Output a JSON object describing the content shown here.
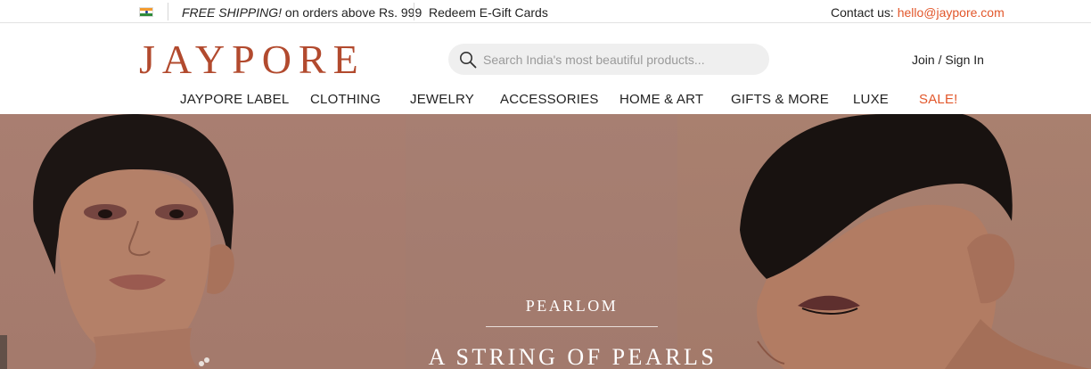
{
  "topbar": {
    "flag_icon": "india-flag-icon",
    "shipping_prefix": "FREE SHIPPING!",
    "shipping_rest": " on orders above Rs. 999",
    "gift_cards": "Redeem E-Gift Cards",
    "contact_label": "Contact us: ",
    "contact_email": "hello@jaypore.com"
  },
  "header": {
    "logo": "JAYPORE",
    "search_placeholder": "Search India's most beautiful products...",
    "search_icon": "search-icon",
    "signin": "Join / Sign In"
  },
  "nav": {
    "items": [
      "JAYPORE LABEL",
      "CLOTHING",
      "JEWELRY",
      "ACCESSORIES",
      "HOME & ART",
      "GIFTS & MORE",
      "LUXE",
      "SALE!"
    ]
  },
  "hero": {
    "eyebrow": "PEARLOM",
    "title": "A STRING OF PEARLS"
  },
  "colors": {
    "brand": "#b24a2e",
    "accent": "#e2572b",
    "hero_bg": "#a87e70"
  }
}
